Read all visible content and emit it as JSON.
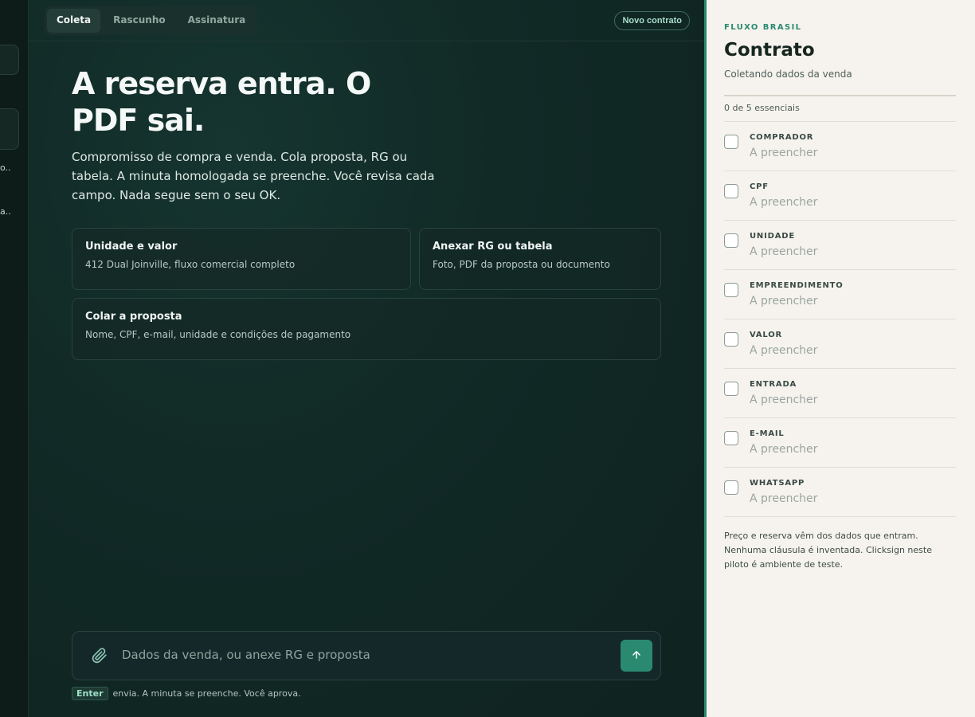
{
  "rail": {
    "items": [
      "o...",
      "a..."
    ]
  },
  "header": {
    "tabs": [
      {
        "label": "Coleta",
        "active": true
      },
      {
        "label": "Rascunho",
        "active": false
      },
      {
        "label": "Assinatura",
        "active": false
      }
    ],
    "new_contract_label": "Novo contrato"
  },
  "hero": {
    "title": "A reserva entra. O PDF sai.",
    "subtitle": "Compromisso de compra e venda. Cola proposta, RG ou tabela. A minuta homologada se preenche. Você revisa cada campo. Nada segue sem o seu OK."
  },
  "cards": [
    {
      "title": "Unidade e valor",
      "description": "412 Dual Joinville, fluxo comercial completo"
    },
    {
      "title": "Anexar RG ou tabela",
      "description": "Foto, PDF da proposta ou documento"
    },
    {
      "title": "Colar a proposta",
      "description": "Nome, CPF, e-mail, unidade e condições de pagamento"
    }
  ],
  "composer": {
    "placeholder": "Dados da venda, ou anexe RG e proposta",
    "value": "",
    "hint_key": "Enter",
    "hint_text": "envia. A minuta se preenche. Você aprova."
  },
  "panel": {
    "brand": "FLUXO BRASIL",
    "title": "Contrato",
    "subtitle": "Coletando dados da venda",
    "progress": {
      "label": "0 de 5 essenciais",
      "done": 0,
      "total": 5
    },
    "fields": [
      {
        "label": "COMPRADOR",
        "value": "A preencher",
        "checked": false
      },
      {
        "label": "CPF",
        "value": "A preencher",
        "checked": false
      },
      {
        "label": "UNIDADE",
        "value": "A preencher",
        "checked": false
      },
      {
        "label": "EMPREENDIMENTO",
        "value": "A preencher",
        "checked": false
      },
      {
        "label": "VALOR",
        "value": "A preencher",
        "checked": false
      },
      {
        "label": "ENTRADA",
        "value": "A preencher",
        "checked": false
      },
      {
        "label": "E-MAIL",
        "value": "A preencher",
        "checked": false
      },
      {
        "label": "WHATSAPP",
        "value": "A preencher",
        "checked": false
      }
    ],
    "footnote": "Preço e reserva vêm dos dados que entram. Nenhuma cláusula é inventada. Clicksign neste piloto é ambiente de teste."
  },
  "colors": {
    "accent": "#2a8a70",
    "background": "#0f1f1c",
    "panel": "#f6f3ee"
  },
  "icons": {
    "attach": "paperclip-icon",
    "send": "arrow-up-icon"
  }
}
